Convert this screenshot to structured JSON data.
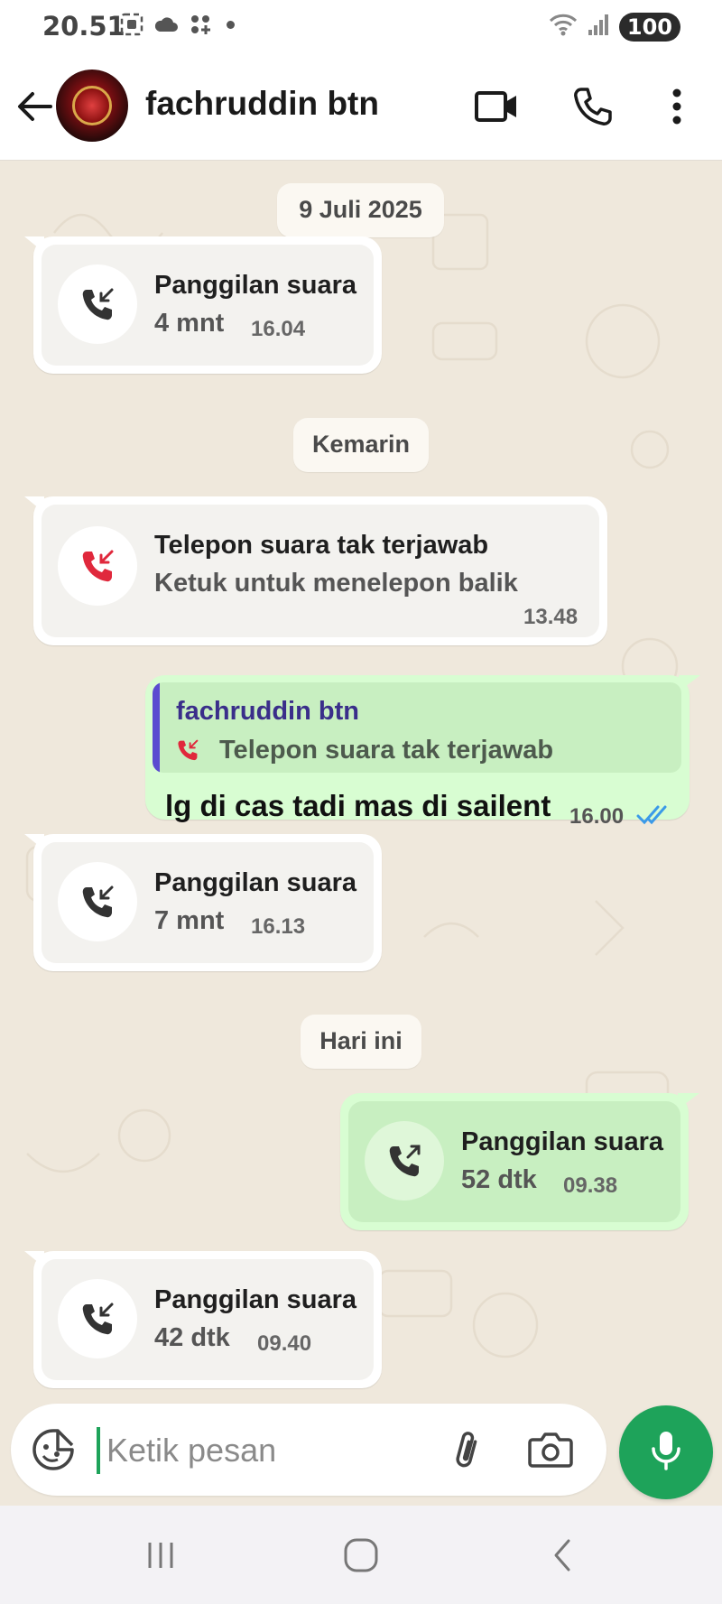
{
  "status_bar": {
    "time": "20.51",
    "battery": "100",
    "icons": [
      "screenshot-icon",
      "cloud-icon",
      "apps-icon",
      "notification-dot",
      "wifi-icon",
      "signal-icon"
    ]
  },
  "header": {
    "contact_name": "fachruddin btn",
    "icons": [
      "back-arrow-icon",
      "avatar",
      "video-call-icon",
      "voice-call-icon",
      "more-options-icon"
    ]
  },
  "chat": {
    "wallpaper_color": "#efe8dc",
    "messages": [
      {
        "type": "date",
        "label": "9 Juli 2025"
      },
      {
        "type": "call",
        "direction": "in",
        "icon": "incoming-call-icon",
        "title": "Panggilan suara",
        "subtitle": "4 mnt",
        "time": "16.04"
      },
      {
        "type": "date",
        "label": "Kemarin"
      },
      {
        "type": "call",
        "direction": "in",
        "icon": "missed-call-icon",
        "title": "Telepon suara tak terjawab",
        "subtitle": "Ketuk untuk menelepon balik",
        "time": "13.48"
      },
      {
        "type": "reply",
        "direction": "out",
        "quote_author": "fachruddin btn",
        "quote_text": "Telepon suara tak terjawab",
        "text": "lg di cas tadi mas di sailent",
        "time": "16.00",
        "status": "read"
      },
      {
        "type": "call",
        "direction": "in",
        "icon": "incoming-call-icon",
        "title": "Panggilan suara",
        "subtitle": "7 mnt",
        "time": "16.13"
      },
      {
        "type": "date",
        "label": "Hari ini"
      },
      {
        "type": "call",
        "direction": "out",
        "icon": "outgoing-call-icon",
        "title": "Panggilan suara",
        "subtitle": "52 dtk",
        "time": "09.38"
      },
      {
        "type": "call",
        "direction": "in",
        "icon": "incoming-call-icon",
        "title": "Panggilan suara",
        "subtitle": "42 dtk",
        "time": "09.40"
      }
    ]
  },
  "composer": {
    "placeholder": "Ketik pesan",
    "value": ""
  },
  "colors": {
    "accent_green": "#1ea35a",
    "missed_red": "#e0283c",
    "read_tick_blue": "#3b9ae8",
    "out_bubble": "#d8fdd2",
    "quote_bar": "#5b4bd0"
  }
}
